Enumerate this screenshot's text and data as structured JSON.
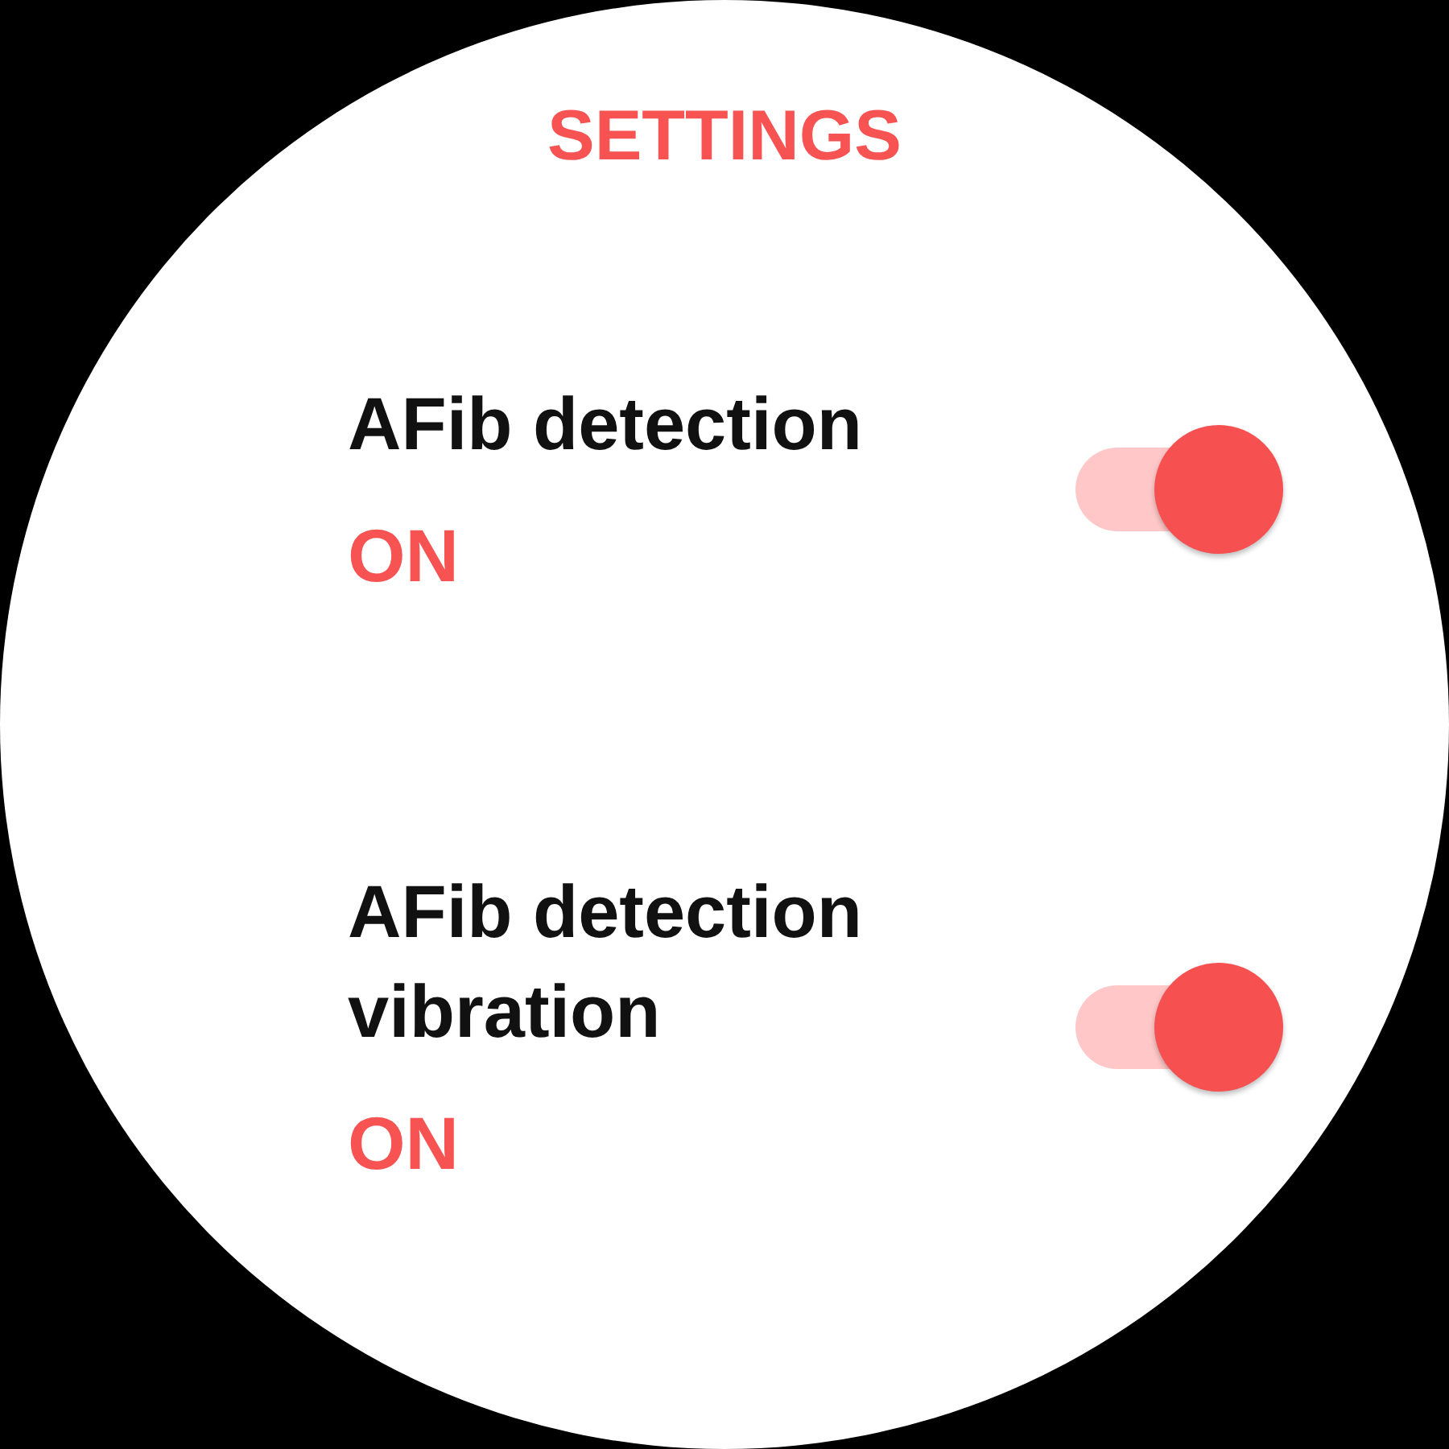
{
  "title": "SETTINGS",
  "settings": [
    {
      "label": "AFib detection",
      "status": "ON",
      "on": true
    },
    {
      "label": "AFib detection vibration",
      "status": "ON",
      "on": true
    }
  ]
}
